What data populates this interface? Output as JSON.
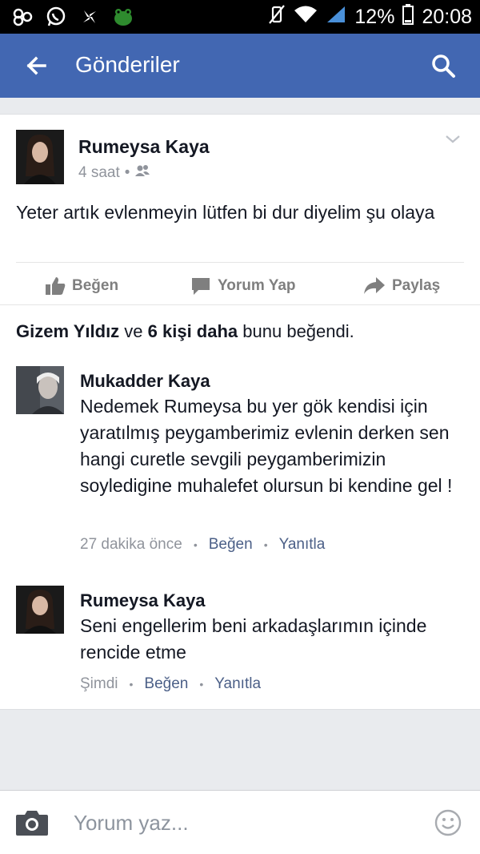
{
  "status_bar": {
    "battery": "12%",
    "time": "20:08",
    "left_icons": [
      "gesture-icon",
      "whatsapp-icon",
      "pinwheel-icon",
      "frog-icon"
    ],
    "right_icons": [
      "vibrate-off-icon",
      "wifi-icon",
      "signal-icon",
      "battery-icon"
    ]
  },
  "header": {
    "title": "Gönderiler",
    "color": "#4267b2"
  },
  "post": {
    "author": "Rumeysa Kaya",
    "time": "4 saat",
    "audience_icon": "friends-icon",
    "text": "Yeter artık evlenmeyin lütfen bi dur diyelim şu olaya",
    "actions": {
      "like": "Beğen",
      "comment": "Yorum Yap",
      "share": "Paylaş"
    }
  },
  "likes": {
    "first": "Gizem Yıldız",
    "and": " ve ",
    "others": "6 kişi daha",
    "suffix": " bunu beğendi."
  },
  "comments": [
    {
      "author": "Mukadder Kaya",
      "text": "Nedemek Rumeysa bu yer gök kendisi için yaratılmış peygamberimiz evlenin derken sen hangi curetle sevgili peygamberimizin soyledigine muhalefet olursun bi kendine gel !",
      "time": "27 dakika önce",
      "like": "Beğen",
      "reply": "Yanıtla"
    },
    {
      "author": "Rumeysa Kaya",
      "text": "Seni engellerim beni arkadaşlarımın içinde rencide etme",
      "time": "Şimdi",
      "like": "Beğen",
      "reply": "Yanıtla"
    }
  ],
  "composer": {
    "placeholder": "Yorum yaz..."
  }
}
